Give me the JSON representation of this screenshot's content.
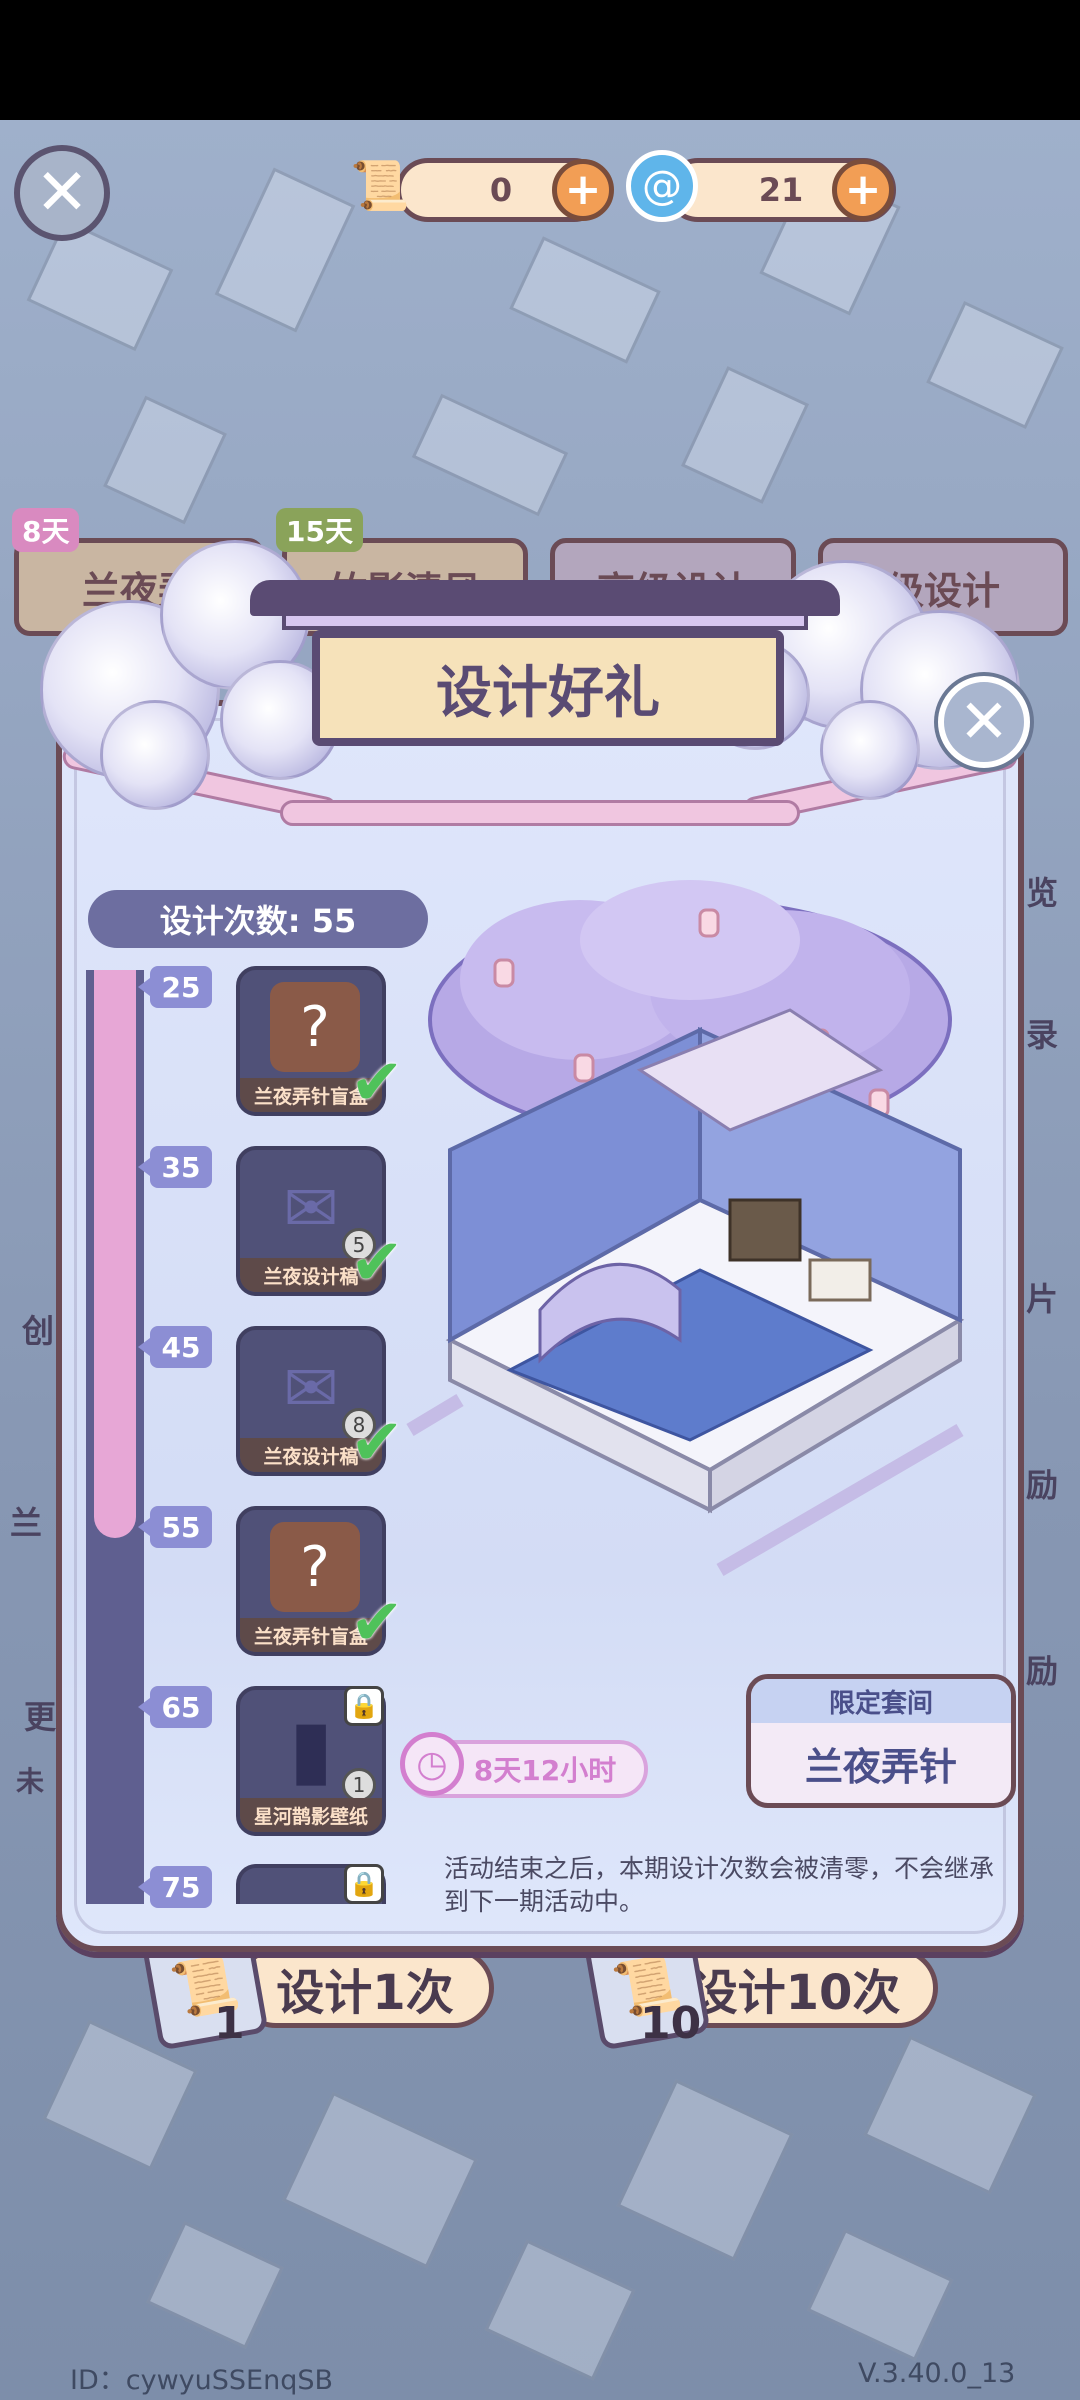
{
  "currencies": [
    {
      "icon": "design-scroll-icon",
      "value": "0"
    },
    {
      "icon": "spiral-gem-icon",
      "value": "21"
    }
  ],
  "tabs": [
    {
      "label": "兰夜弄",
      "badge": "8天"
    },
    {
      "label": "竹影清风",
      "badge": "15天"
    },
    {
      "label": "高级设计",
      "badge": ""
    },
    {
      "label": "级设计",
      "badge": ""
    }
  ],
  "side_peek": {
    "right": [
      "览",
      "录",
      "片",
      "励",
      "励"
    ],
    "left": [
      "创",
      "兰",
      "更",
      "未"
    ]
  },
  "modal": {
    "title": "设计好礼",
    "design_count_label": "设计次数: 55",
    "progress": 0.6,
    "milestones": [
      {
        "threshold": "25",
        "label": "兰夜弄针盲盒",
        "art": "?",
        "qty": "",
        "claimed": true,
        "locked": false
      },
      {
        "threshold": "35",
        "label": "兰夜设计稿",
        "art": "✉",
        "qty": "5",
        "claimed": true,
        "locked": false
      },
      {
        "threshold": "45",
        "label": "兰夜设计稿",
        "art": "✉",
        "qty": "8",
        "claimed": true,
        "locked": false
      },
      {
        "threshold": "55",
        "label": "兰夜弄针盲盒",
        "art": "?",
        "qty": "",
        "claimed": true,
        "locked": false
      },
      {
        "threshold": "65",
        "label": "星河鹊影壁纸",
        "art": "▮",
        "qty": "1",
        "claimed": false,
        "locked": true
      },
      {
        "threshold": "75",
        "label": "",
        "art": "",
        "qty": "",
        "claimed": false,
        "locked": true
      }
    ],
    "timer": "8天12小时",
    "limited_header": "限定套间",
    "limited_name": "兰夜弄针",
    "notice": "活动结束之后，本期设计次数会被清零，不会继承到下一期活动中。"
  },
  "bottom": {
    "design_once_label": "设计1次",
    "design_once_count": "1",
    "design_ten_label": "设计10次",
    "design_ten_count": "10"
  },
  "footer": {
    "user_id": "ID：cywyuSSEnqSB",
    "version": "V.3.40.0_13"
  },
  "colors": {
    "accent_pink": "#e7a7d6",
    "track_purple": "#5f5f90",
    "check_green": "#4fc25a",
    "text_purple": "#5a4b73"
  }
}
